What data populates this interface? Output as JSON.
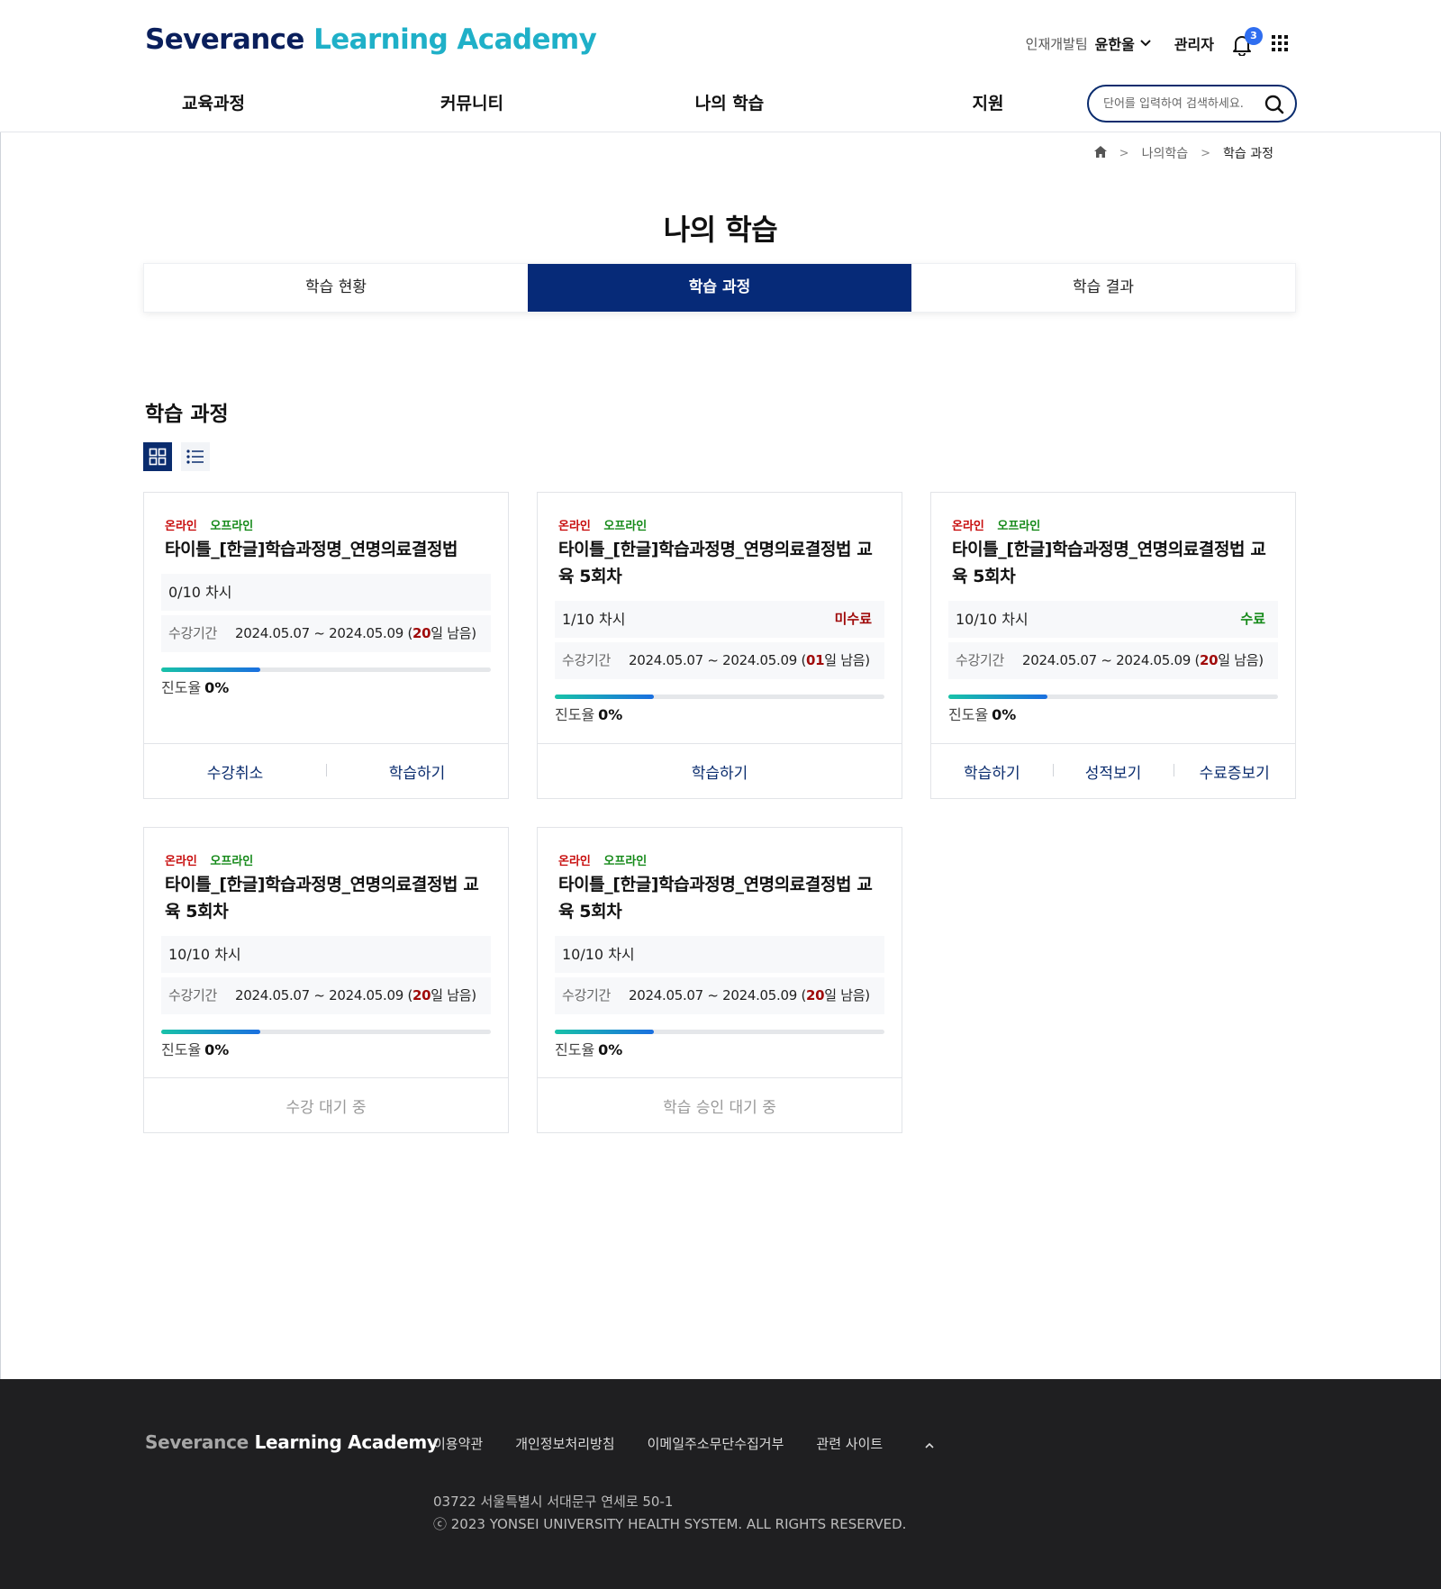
{
  "header": {
    "logo_part1": "Severance",
    "logo_part2": "Learning Academy",
    "team": "인재개발팀",
    "user": "윤한울",
    "admin": "관리자",
    "notification_count": "3",
    "nav": [
      "교육과정",
      "커뮤니티",
      "나의 학습",
      "지원"
    ],
    "search_placeholder": "단어를 입력하여 검색하세요."
  },
  "breadcrumb": {
    "level1": "나의학습",
    "current": "학습 과정"
  },
  "page_title": "나의 학습",
  "tabs": [
    "학습 현황",
    "학습 과정",
    "학습 결과"
  ],
  "active_tab": 1,
  "section_title": "학습 과정",
  "cards": [
    {
      "tag_online": "온라인",
      "tag_offline": "오프라인",
      "title": "타이틀_[한글]학습과정명_연명의료결정법",
      "sessions": "0/10 차시",
      "status": "",
      "period_label": "수강기간",
      "period": "2024.05.07 ~ 2024.05.09 (",
      "remain_num": "20",
      "remain_suffix": "일 남음)",
      "progress_label": "진도율",
      "progress_value": "0%",
      "progress_fill": 0.3,
      "actions": [
        "수강취소",
        "학습하기"
      ]
    },
    {
      "tag_online": "온라인",
      "tag_offline": "오프라인",
      "title": "타이틀_[한글]학습과정명_연명의료결정법 교육 5회차",
      "sessions": "1/10 차시",
      "status": "미수료",
      "period_label": "수강기간",
      "period": "2024.05.07 ~ 2024.05.09 (",
      "remain_num": "01",
      "remain_suffix": "일 남음)",
      "progress_label": "진도율",
      "progress_value": "0%",
      "progress_fill": 0.3,
      "actions": [
        "학습하기"
      ]
    },
    {
      "tag_online": "온라인",
      "tag_offline": "오프라인",
      "title": "타이틀_[한글]학습과정명_연명의료결정법 교육 5회차",
      "sessions": "10/10 차시",
      "status": "수료",
      "period_label": "수강기간",
      "period": "2024.05.07 ~ 2024.05.09 (",
      "remain_num": "20",
      "remain_suffix": "일 남음)",
      "progress_label": "진도율",
      "progress_value": "0%",
      "progress_fill": 0.3,
      "actions": [
        "학습하기",
        "성적보기",
        "수료증보기"
      ]
    },
    {
      "tag_online": "온라인",
      "tag_offline": "오프라인",
      "title": "타이틀_[한글]학습과정명_연명의료결정법 교육 5회차",
      "sessions": "10/10 차시",
      "status": "",
      "period_label": "수강기간",
      "period": "2024.05.07 ~ 2024.05.09 (",
      "remain_num": "20",
      "remain_suffix": "일 남음)",
      "progress_label": "진도율",
      "progress_value": "0%",
      "progress_fill": 0.3,
      "wait_text": "수강 대기 중"
    },
    {
      "tag_online": "온라인",
      "tag_offline": "오프라인",
      "title": "타이틀_[한글]학습과정명_연명의료결정법 교육 5회차",
      "sessions": "10/10 차시",
      "status": "",
      "period_label": "수강기간",
      "period": "2024.05.07 ~ 2024.05.09 (",
      "remain_num": "20",
      "remain_suffix": "일 남음)",
      "progress_label": "진도율",
      "progress_value": "0%",
      "progress_fill": 0.3,
      "wait_text": "학습 승인 대기 중"
    }
  ],
  "colors": {
    "primary": "#062a78",
    "online_tag": "#c80e0e",
    "offline_tag": "#168a1a",
    "incomplete": "#a00b0b",
    "complete": "#168a1a",
    "footer_bg": "#1f1f21"
  },
  "footer": {
    "logo_part1": "Severance",
    "logo_part2": "Learning Academy",
    "links": [
      "이용약관",
      "개인정보처리방침",
      "이메일주소무단수집거부",
      "관련 사이트"
    ],
    "address": "03722 서울특별시 서대문구 연세로 50-1",
    "copyright": "ⓒ 2023 YONSEI UNIVERSITY HEALTH SYSTEM. ALL RIGHTS RESERVED."
  }
}
